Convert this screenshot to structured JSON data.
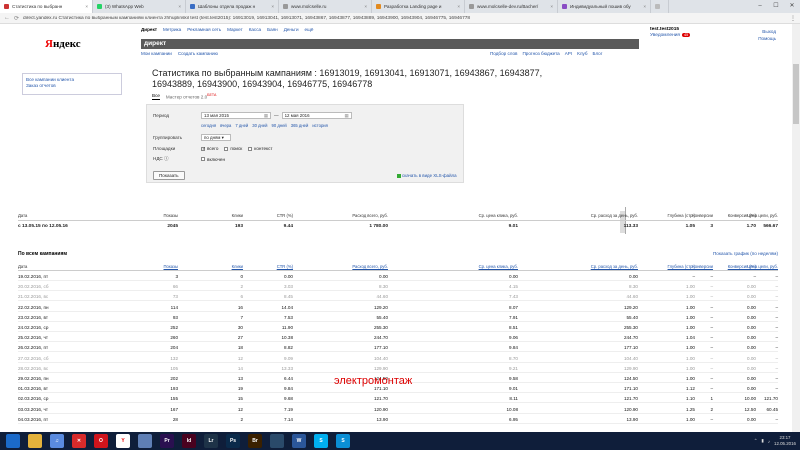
{
  "browser": {
    "tabs": [
      {
        "title": "Статистика по выбранн",
        "active": true,
        "color": "#c33"
      },
      {
        "title": "(3) WhatsApp Web",
        "active": false,
        "color": "#25d366"
      },
      {
        "title": "Шаблоны отдела продаж н",
        "active": false,
        "color": "#3a6ec5"
      },
      {
        "title": "www.molcselle.ru",
        "active": false,
        "color": "#999999"
      },
      {
        "title": "Разработка Landing page и",
        "active": false,
        "color": "#e28a1f"
      },
      {
        "title": "www.molcselle-dev.ru/Bacher/",
        "active": false,
        "color": "#999999"
      },
      {
        "title": "Индивидуальный пошив обу",
        "active": false,
        "color": "#8a4dc4"
      },
      {
        "title": "",
        "active": false,
        "color": "#bbbbbb"
      }
    ],
    "url": "direct.yandex.ru   Статистика по выбранным кампаниям клиента zhhuplinskil test (test.test2015): 16913019, 16913041, 16913071, 16943867, 16943877, 16943889, 16943900, 16943904, 16946775, 16946778"
  },
  "header": {
    "logo": "Яндекс",
    "nav": [
      "Директ",
      "Метрика",
      "Рекламная сеть",
      "Маркет",
      "Касса",
      "Баян",
      "Деньги",
      "ещё"
    ],
    "user_login": "test.test2015",
    "user_sub": "Уведомления",
    "user_badge": "45",
    "right_links": [
      "Выход",
      "Помощь"
    ],
    "bar_title": "директ",
    "sub_links": [
      "Мои кампании",
      "Создать кампанию"
    ],
    "tool_links": [
      "Подбор слов",
      "Прогноз бюджета",
      "API",
      "Клуб",
      "Блог"
    ]
  },
  "sidebar": {
    "links": [
      "Все кампании клиента",
      "Заказ отчетов"
    ]
  },
  "page": {
    "title": "Статистика по выбранным кампаниям : 16913019, 16913041, 16913071, 16943867, 16943877, 16943889, 16943900, 16943904, 16946775, 16946778",
    "tabs": {
      "all": "Все",
      "master": "Мастер отчетов 2.0",
      "beta": "БЕТА"
    }
  },
  "filter": {
    "period_label": "Период",
    "date_from": "13 мая 2015",
    "date_to": "12 мая 2016",
    "quick_links": [
      "сегодня",
      "вчера",
      "7 дней",
      "30 дней",
      "90 дней",
      "365 дней",
      "история"
    ],
    "group_label": "Группировать",
    "group_value": "по дням",
    "platforms_label": "Площадки",
    "platforms": [
      {
        "label": "всего",
        "checked": true
      },
      {
        "label": "поиск",
        "checked": false
      },
      {
        "label": "контекст",
        "checked": false
      }
    ],
    "vat_label": "НДС",
    "vat_option": "включен",
    "show_button": "Показать",
    "xls_link": "скачать в виде XLS-файла"
  },
  "summary": {
    "headers": [
      "Дата",
      "Показы",
      "Клики",
      "CTR (%)",
      "Расход всего, руб.",
      "Ср. цена клика, руб.",
      "Ср. расход за день, руб.",
      "Глубина (стр.)",
      "Конверсии",
      "Конверсия (%)",
      "Цена цели, руб."
    ],
    "row": [
      "с 13.05.15 по 12.05.16",
      "2045",
      "193",
      "9.44",
      "1 780.00",
      "9.01",
      "113.33",
      "1.05",
      "3",
      "1.70",
      "566.67"
    ]
  },
  "detail": {
    "section_title": "По всем кампаниям",
    "graph_link": "Показать график (по неделям)",
    "headers": [
      "Дата",
      "Показы",
      "Клики",
      "CTR (%)",
      "Расход всего, руб.",
      "Ср. цена клика, руб.",
      "Ср. расход за день, руб.",
      "Глубина (стр.)",
      "Конверсии",
      "Конверсия (%)",
      "Цена цели, руб."
    ],
    "rows": [
      {
        "cells": [
          "19.02.2016, пт",
          "3",
          "0",
          "0.00",
          "0.00",
          "0.00",
          "0.00",
          "–",
          "–",
          "–",
          "–"
        ],
        "weekend": false
      },
      {
        "cells": [
          "20.02.2016, сб",
          "66",
          "2",
          "3.03",
          "8.30",
          "4.15",
          "8.30",
          "1.00",
          "–",
          "0.00",
          "–"
        ],
        "weekend": true
      },
      {
        "cells": [
          "21.02.2016, вс",
          "73",
          "6",
          "8.45",
          "44.60",
          "7.43",
          "44.60",
          "1.00",
          "–",
          "0.00",
          "–"
        ],
        "weekend": true
      },
      {
        "cells": [
          "22.02.2016, пн",
          "114",
          "16",
          "14.04",
          "129.20",
          "8.07",
          "129.20",
          "1.00",
          "–",
          "0.00",
          "–"
        ],
        "weekend": false
      },
      {
        "cells": [
          "23.02.2016, вт",
          "93",
          "7",
          "7.53",
          "55.40",
          "7.91",
          "55.40",
          "1.00",
          "–",
          "0.00",
          "–"
        ],
        "weekend": false
      },
      {
        "cells": [
          "24.02.2016, ср",
          "252",
          "30",
          "11.90",
          "255.30",
          "8.51",
          "255.30",
          "1.00",
          "–",
          "0.00",
          "–"
        ],
        "weekend": false
      },
      {
        "cells": [
          "25.02.2016, чт",
          "260",
          "27",
          "10.38",
          "244.70",
          "9.06",
          "244.70",
          "1.04",
          "–",
          "0.00",
          "–"
        ],
        "weekend": false
      },
      {
        "cells": [
          "26.02.2016, пт",
          "204",
          "18",
          "8.82",
          "177.10",
          "9.84",
          "177.10",
          "1.00",
          "–",
          "0.00",
          "–"
        ],
        "weekend": false
      },
      {
        "cells": [
          "27.02.2016, сб",
          "132",
          "12",
          "9.09",
          "104.40",
          "8.70",
          "104.40",
          "1.00",
          "–",
          "0.00",
          "–"
        ],
        "weekend": true
      },
      {
        "cells": [
          "28.02.2016, вс",
          "105",
          "14",
          "13.33",
          "129.90",
          "9.21",
          "129.90",
          "1.00",
          "–",
          "0.00",
          "–"
        ],
        "weekend": true
      },
      {
        "cells": [
          "29.02.2016, пн",
          "202",
          "13",
          "6.44",
          "124.50",
          "9.58",
          "124.50",
          "1.00",
          "–",
          "0.00",
          "–"
        ],
        "weekend": false
      },
      {
        "cells": [
          "01.03.2016, вт",
          "193",
          "19",
          "9.84",
          "171.10",
          "9.01",
          "171.10",
          "1.12",
          "–",
          "0.00",
          "–"
        ],
        "weekend": false
      },
      {
        "cells": [
          "02.03.2016, ср",
          "155",
          "15",
          "9.68",
          "121.70",
          "8.11",
          "121.70",
          "1.10",
          "1",
          "10.00",
          "121.70"
        ],
        "weekend": false
      },
      {
        "cells": [
          "03.03.2016, чт",
          "167",
          "12",
          "7.19",
          "120.90",
          "10.08",
          "120.90",
          "1.25",
          "2",
          "12.50",
          "60.45"
        ],
        "weekend": false
      },
      {
        "cells": [
          "04.03.2016, пт",
          "28",
          "2",
          "7.14",
          "13.90",
          "6.95",
          "13.90",
          "1.00",
          "–",
          "0.00",
          "–"
        ],
        "weekend": false
      }
    ]
  },
  "watermark": "электромонтаж",
  "taskbar": {
    "apps": [
      {
        "name": "windows-start-icon",
        "label": "",
        "color": "#1b6ac9"
      },
      {
        "name": "file-explorer-icon",
        "label": "",
        "color": "#e3b23c"
      },
      {
        "name": "itunes-icon",
        "label": "♫",
        "color": "#5a8be0"
      },
      {
        "name": "app-x-icon",
        "label": "✕",
        "color": "#d92b2b"
      },
      {
        "name": "opera-icon",
        "label": "O",
        "color": "#d0141c"
      },
      {
        "name": "yandex-browser-icon",
        "label": "Y",
        "color": "#ffffff"
      },
      {
        "name": "photos-icon",
        "label": "",
        "color": "#5f7fb5"
      },
      {
        "name": "premiere-icon",
        "label": "Pr",
        "color": "#2a1050"
      },
      {
        "name": "indesign-icon",
        "label": "Id",
        "color": "#49021f"
      },
      {
        "name": "lightroom-icon",
        "label": "Lr",
        "color": "#1e3348"
      },
      {
        "name": "photoshop-icon",
        "label": "Ps",
        "color": "#0a2a4a"
      },
      {
        "name": "bridge-icon",
        "label": "Br",
        "color": "#3a2000"
      },
      {
        "name": "media-encoder-icon",
        "label": "",
        "color": "#2a4a6a"
      },
      {
        "name": "word-icon",
        "label": "W",
        "color": "#2b579a"
      },
      {
        "name": "skype-icon",
        "label": "S",
        "color": "#00aff0"
      },
      {
        "name": "skype-alt-icon",
        "label": "S",
        "color": "#0b8fd6"
      }
    ],
    "time": "23:17",
    "date": "12.05.2016"
  }
}
